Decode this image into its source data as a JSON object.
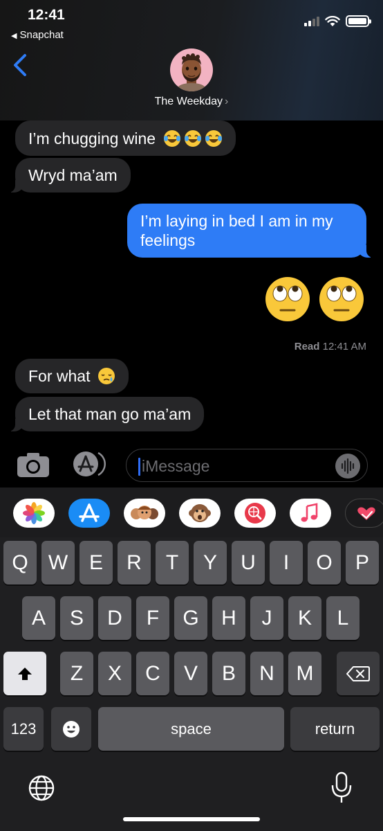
{
  "status": {
    "time": "12:41",
    "back_app": "Snapchat"
  },
  "header": {
    "contact_name": "The Weekday",
    "name_chevron": "›"
  },
  "messages": [
    {
      "id": "m1",
      "direction": "incoming",
      "text": "I’m chugging wine",
      "emoji": [
        "face-with-tears-of-joy",
        "face-with-tears-of-joy",
        "face-with-tears-of-joy"
      ]
    },
    {
      "id": "m2",
      "direction": "incoming",
      "text": "Wryd ma’am"
    },
    {
      "id": "m3",
      "direction": "outgoing",
      "text": "I’m laying in bed I am in my feelings"
    },
    {
      "id": "m4",
      "direction": "outgoing",
      "emoji_only": [
        "face-with-rolling-eyes",
        "face-with-rolling-eyes"
      ]
    },
    {
      "id": "m5",
      "direction": "incoming",
      "text": "For what",
      "emoji": [
        "sleepy-face"
      ]
    },
    {
      "id": "m6",
      "direction": "incoming",
      "text": "Let that man go ma’am"
    }
  ],
  "receipt": {
    "label": "Read",
    "time": "12:41 AM"
  },
  "composer": {
    "placeholder": "iMessage"
  },
  "app_drawer": [
    "photos-app",
    "app-store",
    "memoji-stickers",
    "animoji",
    "search-images",
    "music",
    "digital-touch"
  ],
  "keyboard": {
    "row1": [
      "Q",
      "W",
      "E",
      "R",
      "T",
      "Y",
      "U",
      "I",
      "O",
      "P"
    ],
    "row2": [
      "A",
      "S",
      "D",
      "F",
      "G",
      "H",
      "J",
      "K",
      "L"
    ],
    "row3": [
      "Z",
      "X",
      "C",
      "V",
      "B",
      "N",
      "M"
    ],
    "numbers_label": "123",
    "space_label": "space",
    "return_label": "return"
  },
  "colors": {
    "outgoing_bubble": "#2e7cf6",
    "incoming_bubble": "#262628",
    "accent": "#2f6df5"
  }
}
